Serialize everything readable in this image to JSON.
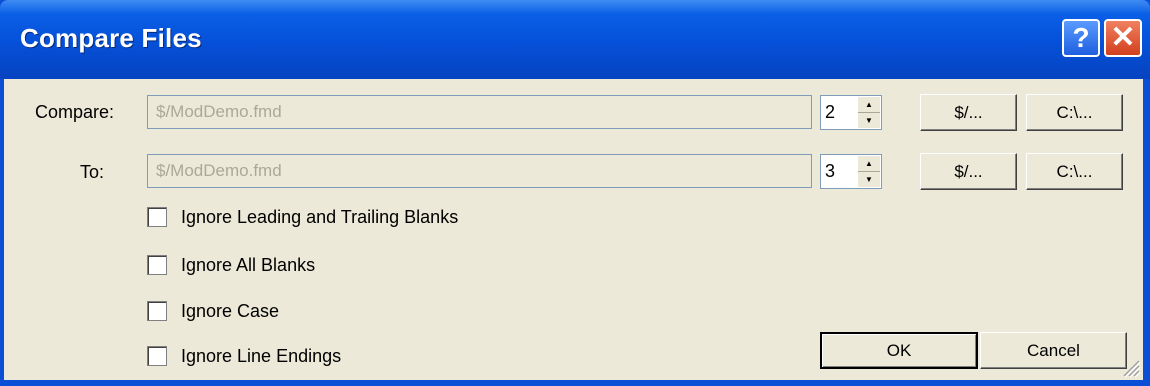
{
  "window": {
    "title": "Compare Files",
    "help_glyph": "?",
    "close_glyph": "✕"
  },
  "compare": {
    "label": "Compare:",
    "path": "$/ModDemo.fmd",
    "version": "2",
    "vss_button": "$/...",
    "local_button": "C:\\..."
  },
  "to": {
    "label": "To:",
    "path": "$/ModDemo.fmd",
    "version": "3",
    "vss_button": "$/...",
    "local_button": "C:\\..."
  },
  "options": [
    {
      "label": "Ignore Leading and Trailing Blanks",
      "checked": false
    },
    {
      "label": "Ignore All Blanks",
      "checked": false
    },
    {
      "label": "Ignore Case",
      "checked": false
    },
    {
      "label": "Ignore Line Endings",
      "checked": false
    }
  ],
  "buttons": {
    "ok": "OK",
    "cancel": "Cancel"
  }
}
